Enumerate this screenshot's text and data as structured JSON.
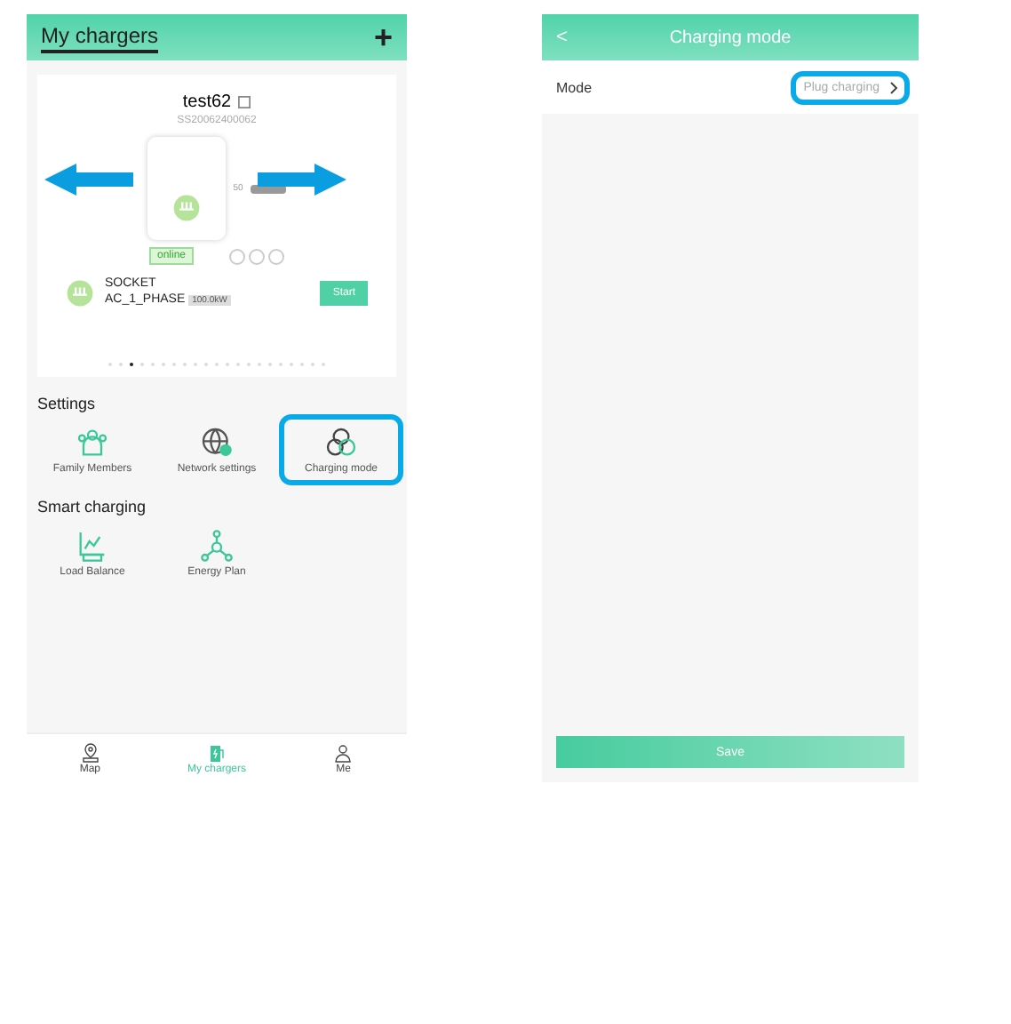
{
  "left_screen": {
    "header": {
      "title": "My chargers",
      "action": "+"
    },
    "charger": {
      "name": "test62",
      "serial": "SS20062400062",
      "distance": "50",
      "status": "online",
      "connector": "SOCKET",
      "phase": "AC_1_PHASE",
      "power": "100.0kW",
      "start_button": "Start",
      "pager": [
        {
          "selected": false
        },
        {
          "selected": false
        },
        {
          "selected": true
        },
        {
          "selected": false
        },
        {
          "selected": false
        },
        {
          "selected": false
        },
        {
          "selected": false
        },
        {
          "selected": false
        },
        {
          "selected": false
        },
        {
          "selected": false
        },
        {
          "selected": false
        },
        {
          "selected": false
        },
        {
          "selected": false
        },
        {
          "selected": false
        },
        {
          "selected": false
        },
        {
          "selected": false
        },
        {
          "selected": false
        },
        {
          "selected": false
        },
        {
          "selected": false
        },
        {
          "selected": false
        },
        {
          "selected": false
        }
      ]
    },
    "sections": [
      {
        "title": "Settings",
        "items": [
          {
            "label": "Family Members",
            "kind": "family",
            "highlighted": false
          },
          {
            "label": "Network settings",
            "kind": "network",
            "highlighted": false
          },
          {
            "label": "Charging mode",
            "kind": "mode",
            "highlighted": true
          }
        ]
      },
      {
        "title": "Smart charging",
        "items": [
          {
            "label": "Load Balance",
            "kind": "balance",
            "highlighted": false
          },
          {
            "label": "Energy Plan",
            "kind": "plan",
            "highlighted": false
          }
        ]
      }
    ],
    "tab_bar": [
      {
        "label": "Map",
        "kind": "map",
        "selected": false
      },
      {
        "label": "My chargers",
        "kind": "charger",
        "selected": true
      },
      {
        "label": "Me",
        "kind": "me",
        "selected": false
      }
    ]
  },
  "right_screen": {
    "header": {
      "back": "<",
      "title": "Charging mode"
    },
    "rows": [
      {
        "label": "Mode",
        "value": "Plug charging",
        "highlighted": true
      }
    ],
    "save_button": "Save"
  }
}
